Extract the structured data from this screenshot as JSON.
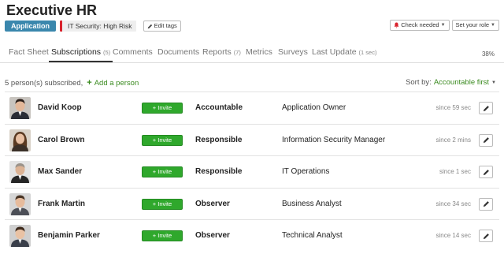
{
  "title": "Executive HR",
  "tags": {
    "application": "Application",
    "risk": "IT Security: High Risk",
    "edit_tags": "Edit tags"
  },
  "top_buttons": {
    "check_needed": "Check needed",
    "set_role": "Set your role"
  },
  "tabs": [
    {
      "label": "Fact Sheet",
      "count": ""
    },
    {
      "label": "Subscriptions",
      "count": "(5)"
    },
    {
      "label": "Comments",
      "count": ""
    },
    {
      "label": "Documents",
      "count": ""
    },
    {
      "label": "Reports",
      "count": "(7)"
    },
    {
      "label": "Metrics",
      "count": ""
    },
    {
      "label": "Surveys",
      "count": ""
    },
    {
      "label": "Last Update",
      "count": "(1 sec)"
    }
  ],
  "active_tab": "Subscriptions",
  "completion": "38%",
  "subscriptions": {
    "summary": "5 person(s) subscribed,",
    "add_person": "Add a person",
    "sort_label": "Sort by:",
    "sort_value": "Accountable first",
    "invite_label": "+ Invite",
    "rows": [
      {
        "name": "David Koop",
        "role": "Accountable",
        "description": "Application Owner",
        "since": "since 59 sec"
      },
      {
        "name": "Carol Brown",
        "role": "Responsible",
        "description": "Information Security Manager",
        "since": "since 2 mins"
      },
      {
        "name": "Max Sander",
        "role": "Responsible",
        "description": "IT Operations",
        "since": "since 1 sec"
      },
      {
        "name": "Frank Martin",
        "role": "Observer",
        "description": "Business Analyst",
        "since": "since 34 sec"
      },
      {
        "name": "Benjamin Parker",
        "role": "Observer",
        "description": "Technical Analyst",
        "since": "since 14 sec"
      }
    ]
  },
  "colors": {
    "accent_green": "#2fa82c",
    "link_green": "#3a8a1f",
    "application_tag": "#3a87ad",
    "risk_marker": "#d9232d"
  }
}
